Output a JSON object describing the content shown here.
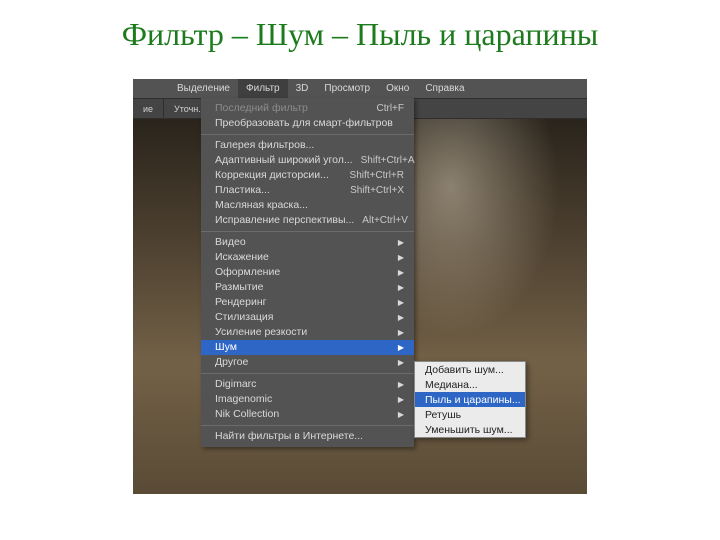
{
  "title": "Фильтр – Шум – Пыль и царапины",
  "menubar": {
    "items": [
      {
        "label": "Выделение"
      },
      {
        "label": "Фильтр"
      },
      {
        "label": "3D"
      },
      {
        "label": "Просмотр"
      },
      {
        "label": "Окно"
      },
      {
        "label": "Справка"
      }
    ],
    "selected_index": 1
  },
  "toolstrip": {
    "seg1": "ие",
    "seg2": "Уточн."
  },
  "filter_menu": {
    "groups": [
      [
        {
          "label": "Последний фильтр",
          "shortcut": "Ctrl+F",
          "disabled": true
        },
        {
          "label": "Преобразовать для смарт-фильтров"
        }
      ],
      [
        {
          "label": "Галерея фильтров..."
        },
        {
          "label": "Адаптивный широкий угол...",
          "shortcut": "Shift+Ctrl+A"
        },
        {
          "label": "Коррекция дисторсии...",
          "shortcut": "Shift+Ctrl+R"
        },
        {
          "label": "Пластика...",
          "shortcut": "Shift+Ctrl+X"
        },
        {
          "label": "Масляная краска..."
        },
        {
          "label": "Исправление перспективы...",
          "shortcut": "Alt+Ctrl+V"
        }
      ],
      [
        {
          "label": "Видео",
          "arrow": true
        },
        {
          "label": "Искажение",
          "arrow": true
        },
        {
          "label": "Оформление",
          "arrow": true
        },
        {
          "label": "Размытие",
          "arrow": true
        },
        {
          "label": "Рендеринг",
          "arrow": true
        },
        {
          "label": "Стилизация",
          "arrow": true
        },
        {
          "label": "Усиление резкости",
          "arrow": true
        },
        {
          "label": "Шум",
          "arrow": true,
          "highlight": true
        },
        {
          "label": "Другое",
          "arrow": true
        }
      ],
      [
        {
          "label": "Digimarc",
          "arrow": true
        },
        {
          "label": "Imagenomic",
          "arrow": true
        },
        {
          "label": "Nik Collection",
          "arrow": true
        }
      ],
      [
        {
          "label": "Найти фильтры в Интернете..."
        }
      ]
    ]
  },
  "noise_submenu": {
    "items": [
      {
        "label": "Добавить шум..."
      },
      {
        "label": "Медиана..."
      },
      {
        "label": "Пыль и царапины...",
        "highlight": true
      },
      {
        "label": "Ретушь"
      },
      {
        "label": "Уменьшить шум..."
      }
    ]
  }
}
